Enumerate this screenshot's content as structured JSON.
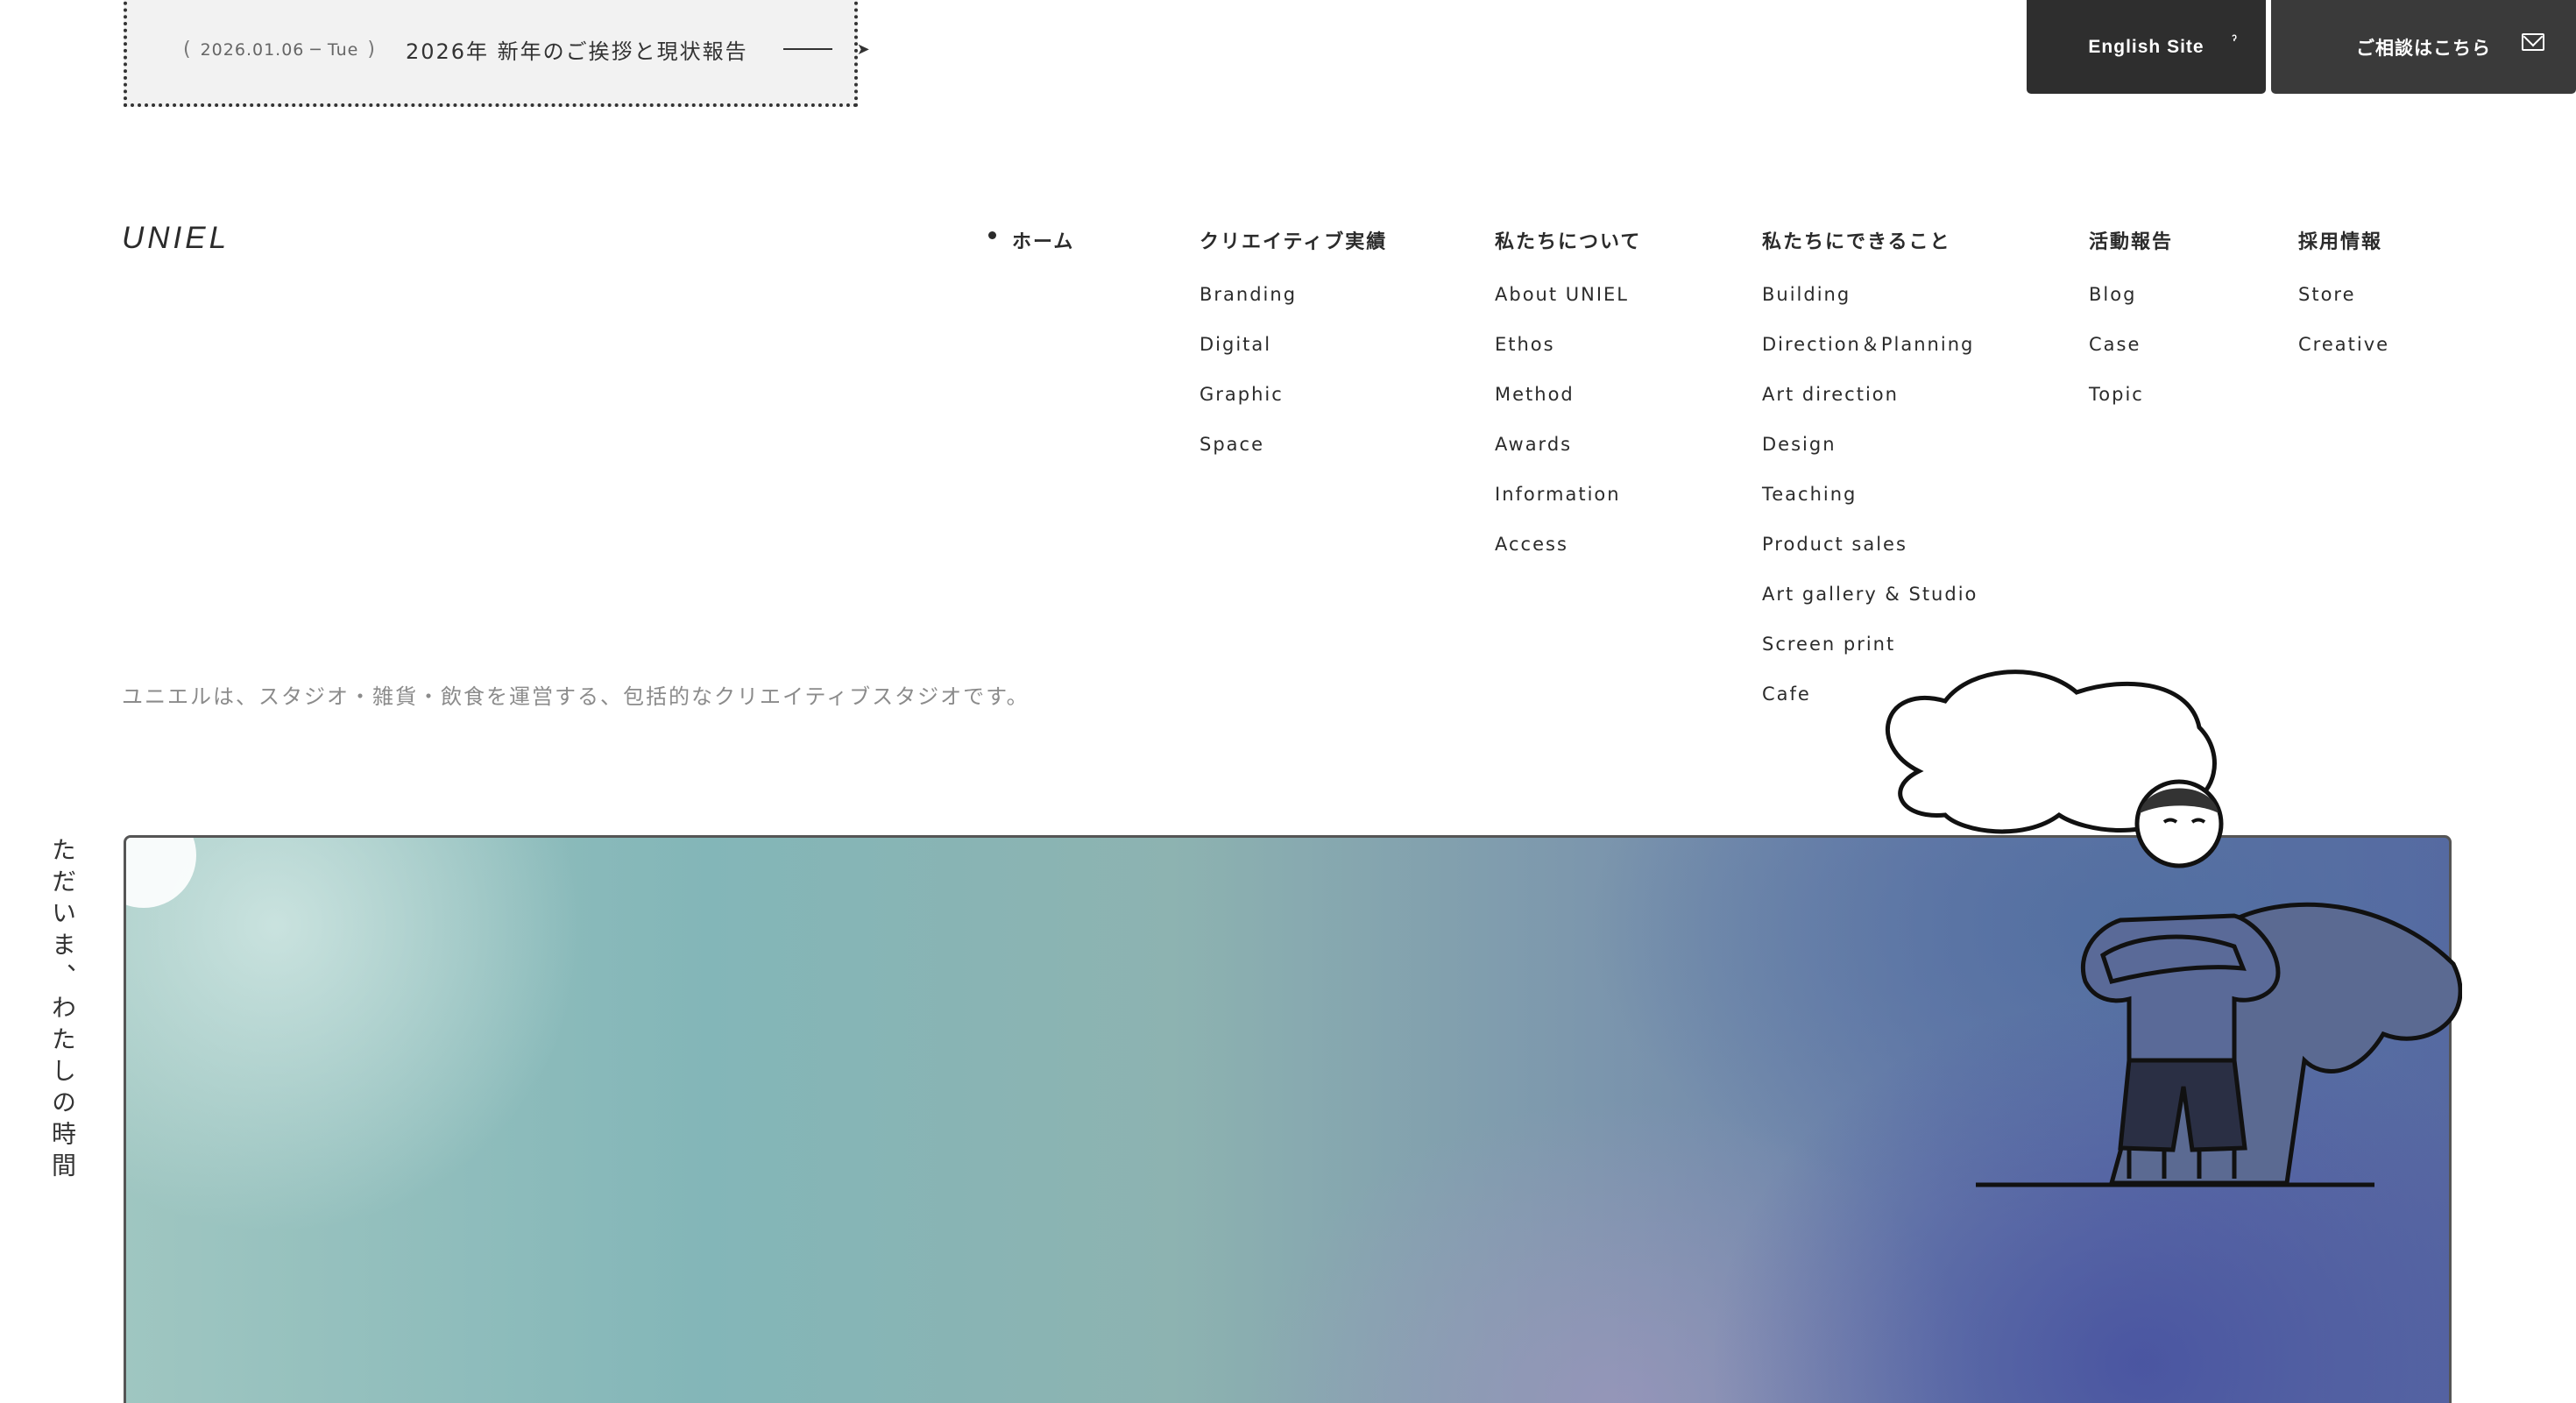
{
  "news": {
    "date": "2026.01.06 ─ Tue",
    "open_paren": "(",
    "close_paren": ")",
    "title": "2026年 新年のご挨拶と現状報告",
    "arrow_head": "➤"
  },
  "header_buttons": {
    "english": "English Site",
    "english_icon": "ˀ",
    "contact": "ご相談はこちら",
    "contact_icon": "mail-icon"
  },
  "logo": "UNIEL",
  "nav": {
    "home": "ホーム",
    "works": {
      "heading": "クリエイティブ実績",
      "items": [
        "Branding",
        "Digital",
        "Graphic",
        "Space"
      ]
    },
    "about": {
      "heading": "私たちについて",
      "items": [
        "About UNIEL",
        "Ethos",
        "Method",
        "Awards",
        "Information",
        "Access"
      ]
    },
    "services": {
      "heading": "私たちにできること",
      "items": [
        "Building",
        "Direction＆Planning",
        "Art direction",
        "Design",
        "Teaching",
        "Product sales",
        "Art gallery & Studio",
        "Screen print",
        "Cafe"
      ]
    },
    "reports": {
      "heading": "活動報告",
      "items": [
        "Blog",
        "Case",
        "Topic"
      ]
    },
    "recruit": {
      "heading": "採用情報",
      "items": [
        "Store",
        "Creative"
      ]
    }
  },
  "tagline": "ユニエルは、スタジオ・雑貨・飲食を運営する、包括的なクリエイティブスタジオです。",
  "vertical_text": "ただいま、わたしの時間",
  "colors": {
    "button_bg": "#2e2e2e",
    "text": "#2b2b2b",
    "muted": "#8b8b8b"
  }
}
